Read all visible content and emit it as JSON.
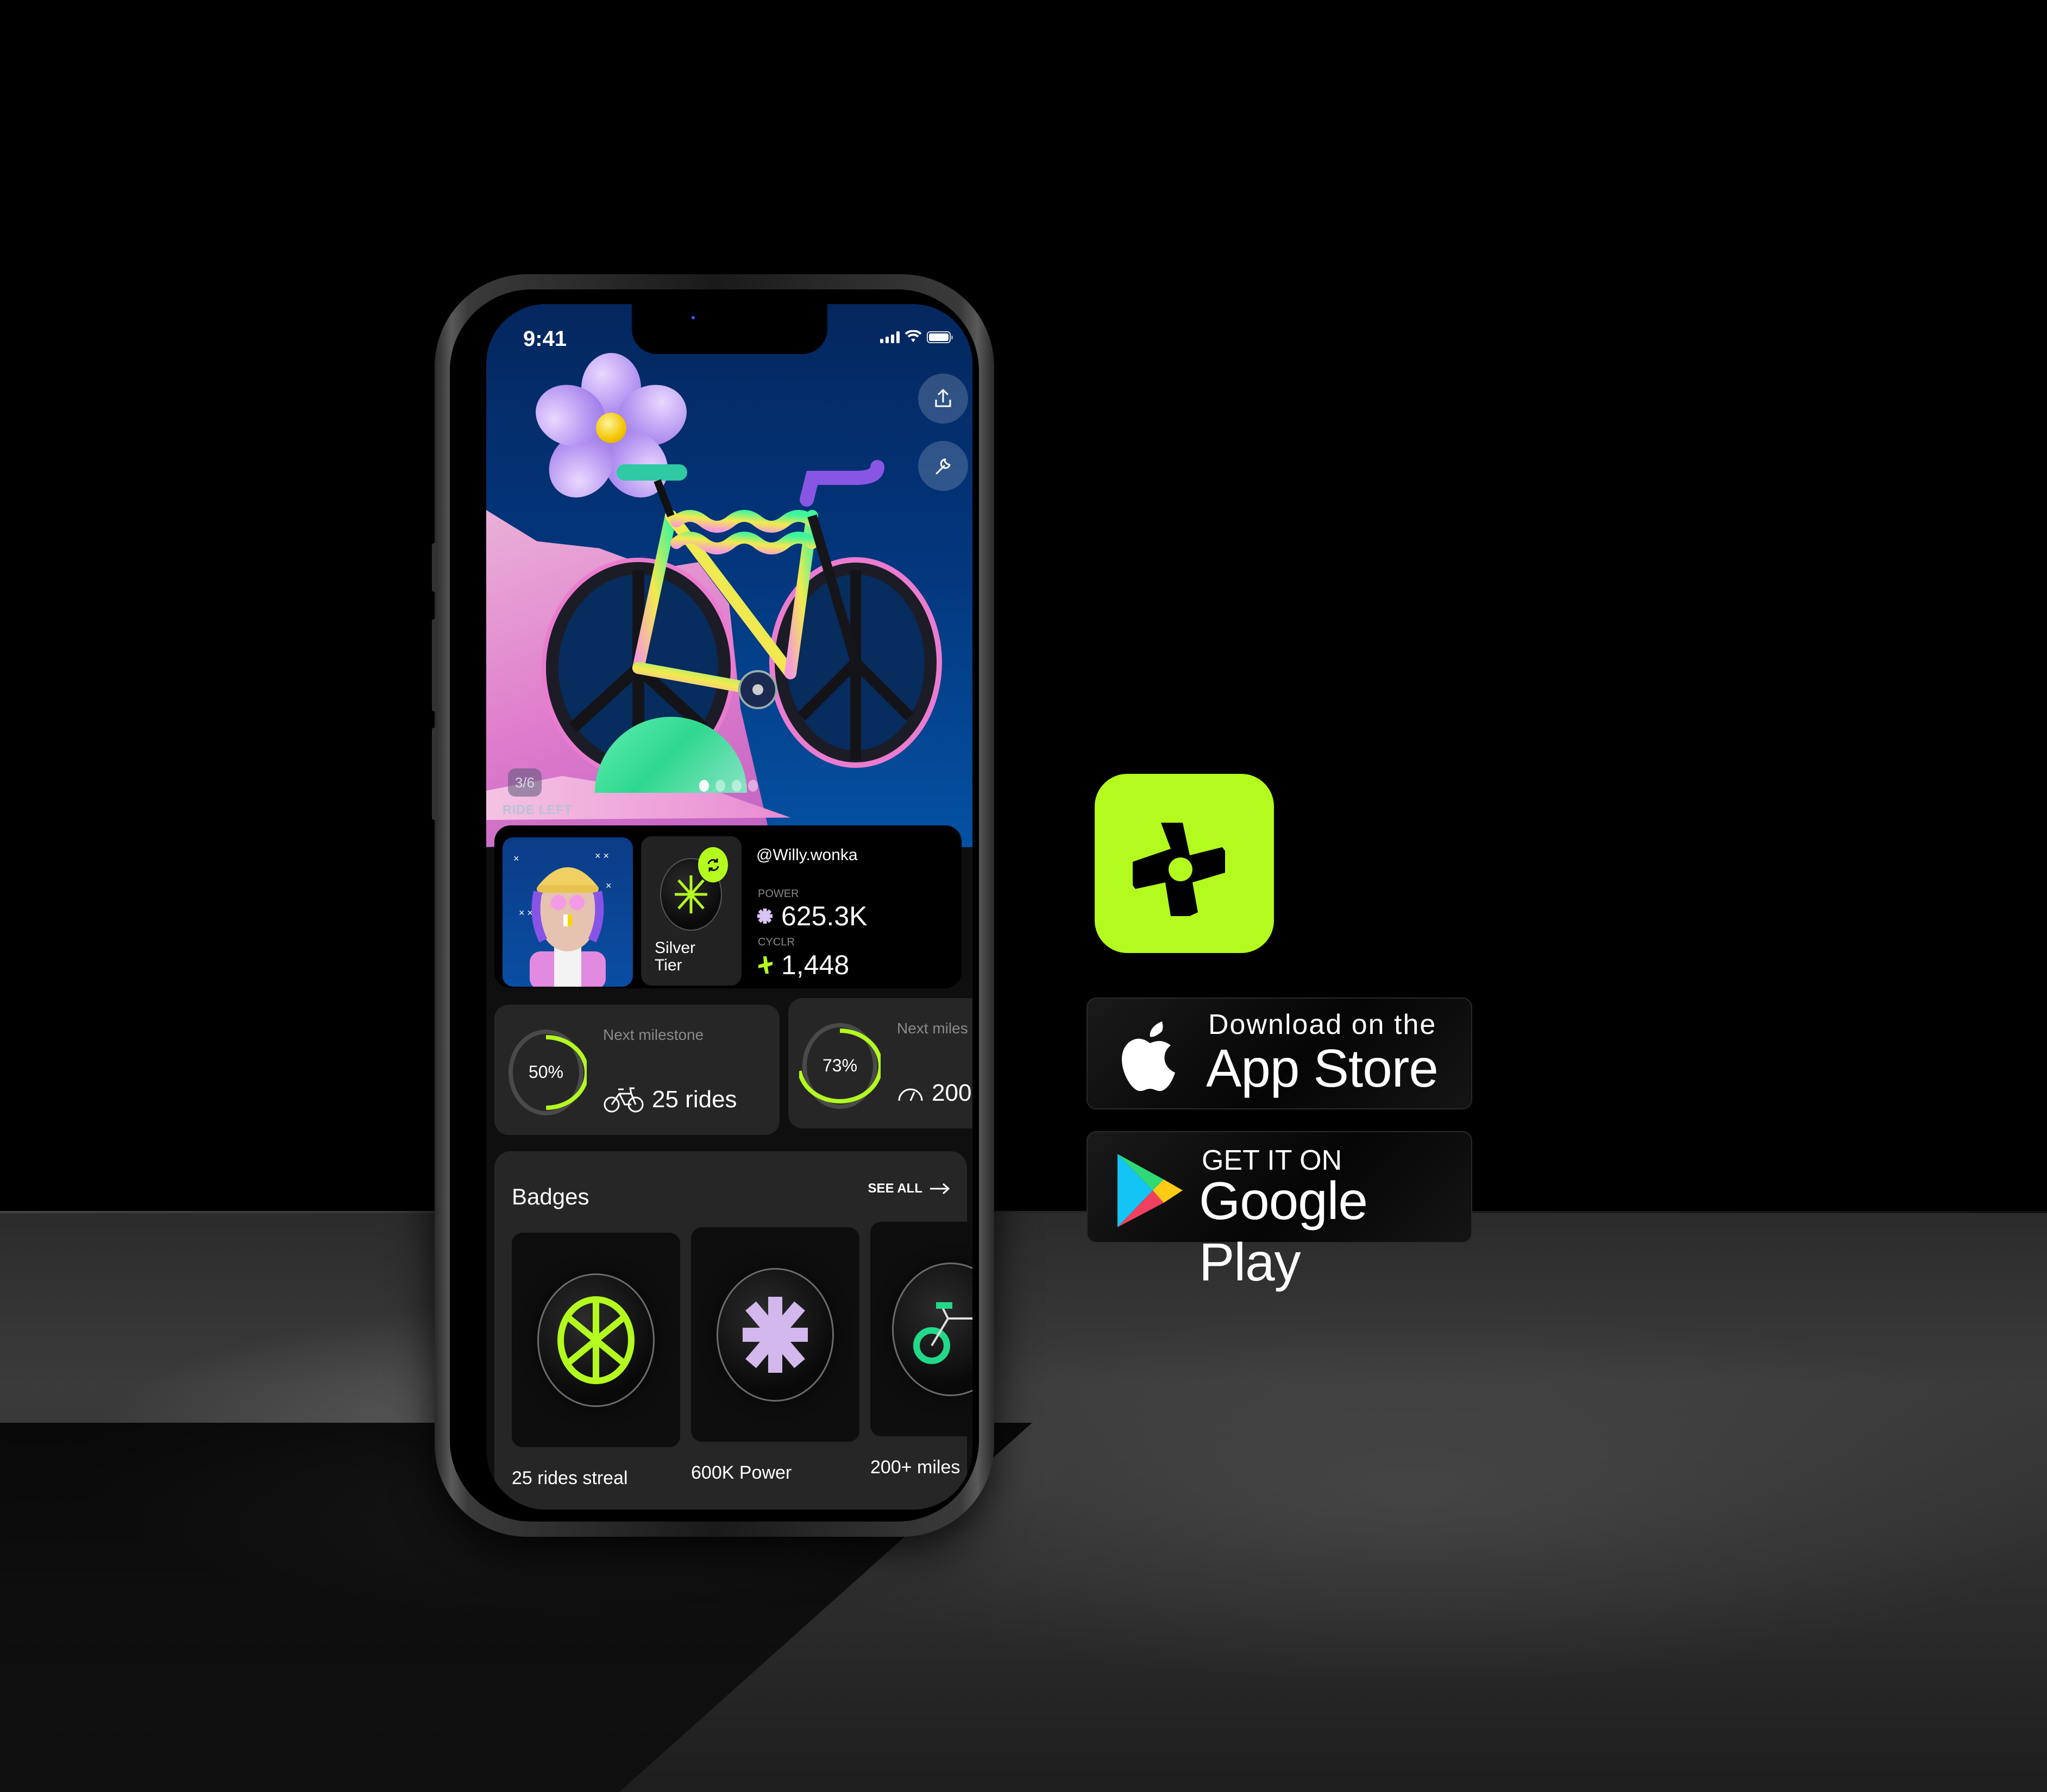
{
  "status_bar": {
    "time": "9:41"
  },
  "hero": {
    "counter": "3/6",
    "label": "RIDE LEFT",
    "pager": {
      "total": 4,
      "active": 0
    },
    "actions": [
      {
        "icon": "share-icon"
      },
      {
        "icon": "wrench-icon"
      }
    ]
  },
  "profile": {
    "username": "@Willy.wonka",
    "tier": {
      "line1": "Silver",
      "line2": "Tier"
    },
    "stats": [
      {
        "caption": "POWER",
        "value": "625.3K",
        "icon": "asterisk-icon",
        "color": "#d9c4f5"
      },
      {
        "caption": "CYCLR",
        "value": "1,448",
        "icon": "cyclr-icon",
        "color": "#b3fa1f"
      }
    ]
  },
  "milestones": [
    {
      "label": "Next milestone",
      "percent_label": "50%",
      "progress": 0.5,
      "value": "25 rides",
      "icon": "bike-icon"
    },
    {
      "label": "Next miles",
      "percent_label": "73%",
      "progress": 0.73,
      "value": "200",
      "icon": "speedometer-icon"
    }
  ],
  "badges": {
    "title": "Badges",
    "see_all": "SEE ALL",
    "items": [
      {
        "name": "25 rides streal",
        "icon": "wheel-badge-icon",
        "color": "#b3fa1f"
      },
      {
        "name": "600K Power",
        "icon": "asterisk-badge-icon",
        "color": "#d2b8ec"
      },
      {
        "name": "200+ miles",
        "icon": "bike-badge-icon",
        "color": "#22d98a"
      }
    ]
  },
  "promo": {
    "accent_color": "#b3fa1f",
    "app_store": {
      "small": "Download on the",
      "big": "App Store"
    },
    "google_play": {
      "small": "GET IT ON",
      "big": "Google Play"
    }
  }
}
